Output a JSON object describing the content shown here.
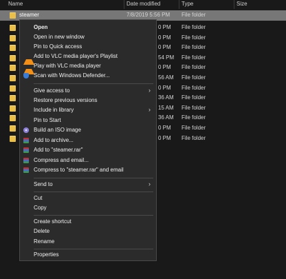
{
  "columns": {
    "name": "Name",
    "date": "Date modified",
    "type": "Type",
    "size": "Size"
  },
  "selected_row": {
    "name": "steamer",
    "date": "7/8/2019 5:56 PM",
    "type": "File folder"
  },
  "rows": [
    {
      "date": "0 PM",
      "type": "File folder"
    },
    {
      "date": "0 PM",
      "type": "File folder"
    },
    {
      "date": "0 PM",
      "type": "File folder"
    },
    {
      "date": "54 PM",
      "type": "File folder"
    },
    {
      "date": "0 PM",
      "type": "File folder"
    },
    {
      "date": "56 AM",
      "type": "File folder"
    },
    {
      "date": "0 PM",
      "type": "File folder"
    },
    {
      "date": "36 AM",
      "type": "File folder"
    },
    {
      "date": "15 AM",
      "type": "File folder"
    },
    {
      "date": "36 AM",
      "type": "File folder"
    },
    {
      "date": "0 PM",
      "type": "File folder"
    },
    {
      "date": "0 PM",
      "type": "File folder"
    }
  ],
  "menu": {
    "open": "Open",
    "open_new_window": "Open in new window",
    "pin_quick": "Pin to Quick access",
    "vlc_playlist": "Add to VLC media player's Playlist",
    "vlc_play": "Play with VLC media player",
    "defender": "Scan with Windows Defender...",
    "give_access": "Give access to",
    "restore": "Restore previous versions",
    "include_library": "Include in library",
    "pin_start": "Pin to Start",
    "build_iso": "Build an ISO image",
    "add_archive": "Add to archive...",
    "add_rar": "Add to \"steamer.rar\"",
    "compress_email": "Compress and email...",
    "compress_rar_email": "Compress to \"steamer.rar\" and email",
    "send_to": "Send to",
    "cut": "Cut",
    "copy": "Copy",
    "create_shortcut": "Create shortcut",
    "delete": "Delete",
    "rename": "Rename",
    "properties": "Properties"
  },
  "icons": {
    "vlc": "vlc-cone-icon",
    "defender": "shield-icon",
    "iso": "disc-icon",
    "rar": "winrar-icon",
    "arrow": "chevron-right-icon"
  }
}
